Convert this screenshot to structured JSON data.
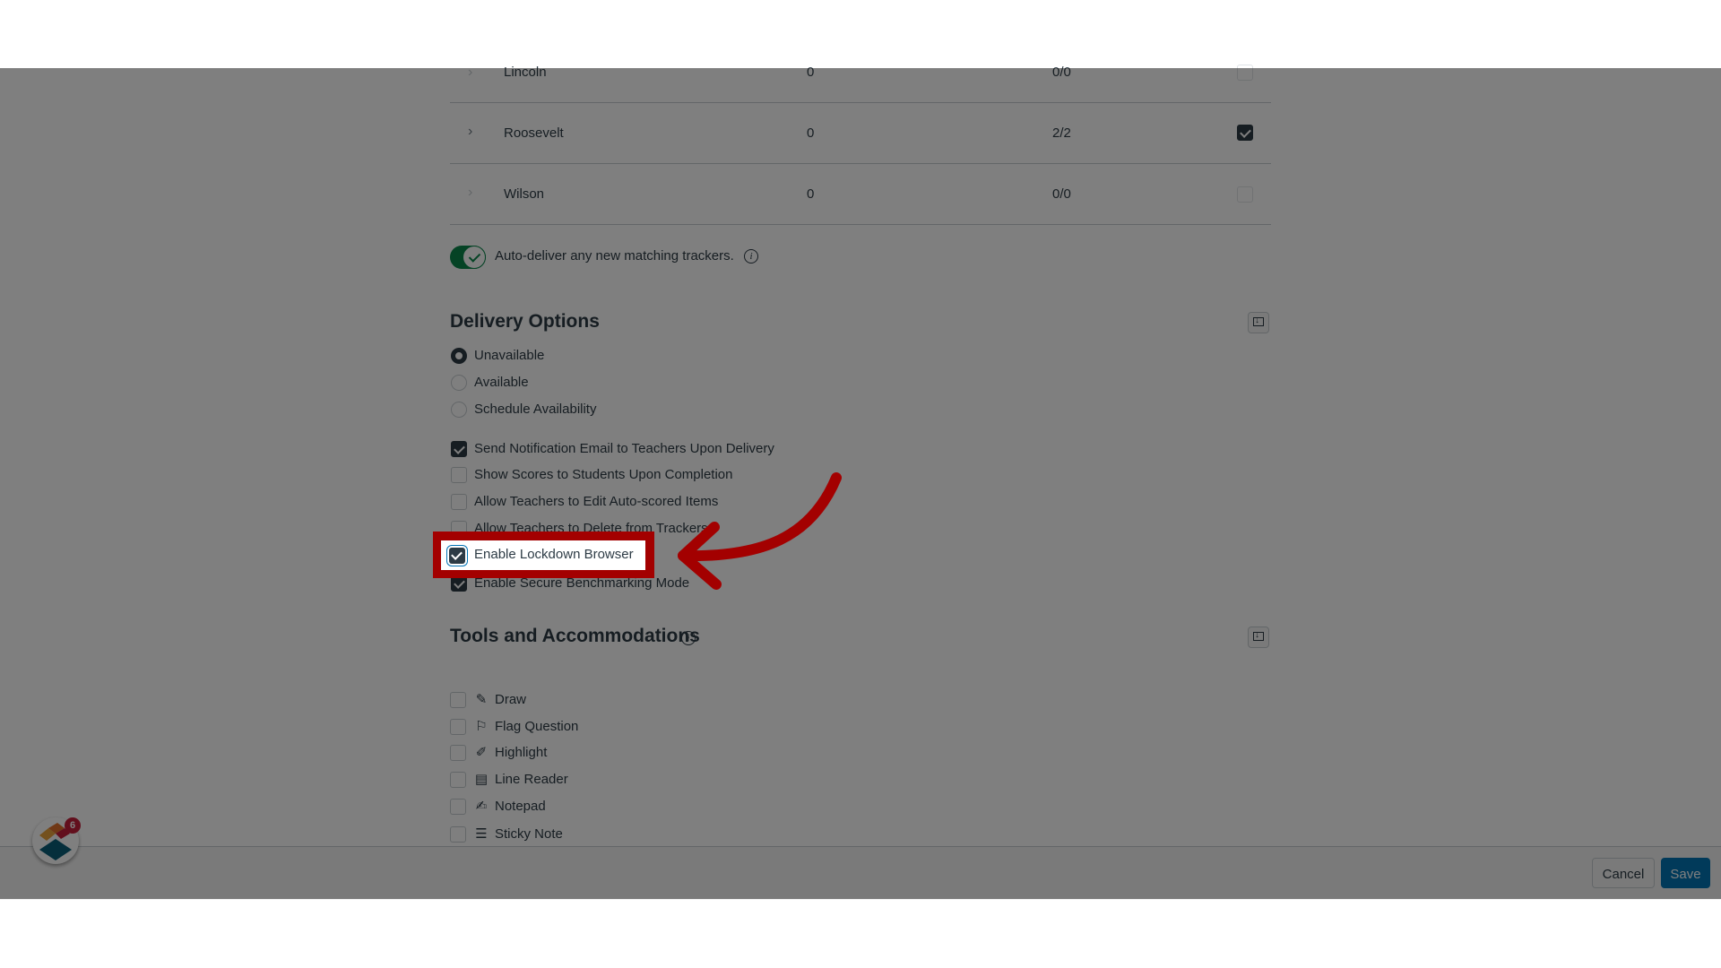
{
  "trackers_table": {
    "rows": [
      {
        "name": "Lincoln",
        "count": "0",
        "delivered": "0/0",
        "selected": false
      },
      {
        "name": "Roosevelt",
        "count": "0",
        "delivered": "2/2",
        "selected": true
      },
      {
        "name": "Wilson",
        "count": "0",
        "delivered": "0/0",
        "selected": false
      }
    ]
  },
  "auto_deliver": {
    "label": "Auto-deliver any new matching trackers.",
    "enabled": true
  },
  "delivery_options": {
    "title": "Delivery Options",
    "radios": [
      {
        "label": "Unavailable",
        "selected": true
      },
      {
        "label": "Available",
        "selected": false
      },
      {
        "label": "Schedule Availability",
        "selected": false
      }
    ],
    "checkboxes": [
      {
        "label": "Send Notification Email to Teachers Upon Delivery",
        "checked": true
      },
      {
        "label": "Show Scores to Students Upon Completion",
        "checked": false
      },
      {
        "label": "Allow Teachers to Edit Auto-scored Items",
        "checked": false
      },
      {
        "label": "Allow Teachers to Delete from Trackers",
        "checked": false
      },
      {
        "label": "Enable Lockdown Browser",
        "checked": true
      },
      {
        "label": "Enable Secure Benchmarking Mode",
        "checked": true
      }
    ]
  },
  "tools": {
    "title": "Tools and Accommodations",
    "items": [
      {
        "label": "Draw",
        "icon": "draw-icon",
        "glyph": "✎",
        "checked": false
      },
      {
        "label": "Flag Question",
        "icon": "flag-icon",
        "glyph": "⚐",
        "checked": false
      },
      {
        "label": "Highlight",
        "icon": "highlighter-icon",
        "glyph": "✐",
        "checked": false
      },
      {
        "label": "Line Reader",
        "icon": "line-reader-icon",
        "glyph": "▤",
        "checked": false
      },
      {
        "label": "Notepad",
        "icon": "notepad-icon",
        "glyph": "✍",
        "checked": false
      },
      {
        "label": "Sticky Note",
        "icon": "sticky-note-icon",
        "glyph": "☰",
        "checked": false
      }
    ]
  },
  "footer": {
    "cancel_label": "Cancel",
    "save_label": "Save"
  },
  "assistant": {
    "badge_count": "6"
  },
  "annotation": {
    "highlighted_label": "Enable Lockdown Browser",
    "color": "#a30000"
  }
}
